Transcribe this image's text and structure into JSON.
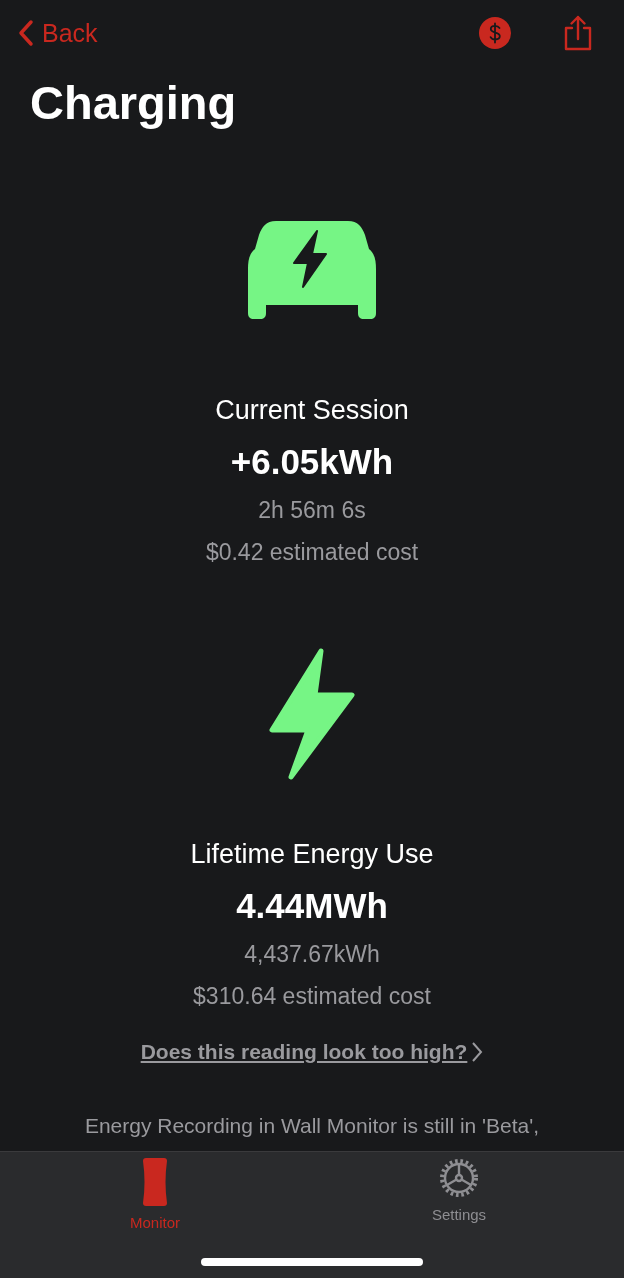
{
  "nav": {
    "back_label": "Back"
  },
  "title": "Charging",
  "sections": [
    {
      "kind": "car",
      "heading": "Current Session",
      "value": "+6.05kWh",
      "details": [
        "2h 56m 6s",
        "$0.42 estimated cost"
      ]
    },
    {
      "kind": "bolt",
      "heading": "Lifetime Energy Use",
      "value": "4.44MWh",
      "details": [
        "4,437.67kWh",
        "$310.64 estimated cost"
      ]
    }
  ],
  "help_link": "Does this reading look too high?",
  "note": "Energy Recording in Wall Monitor is still in 'Beta',",
  "tabs": [
    {
      "kind": "monitor",
      "label": "Monitor",
      "selected": true
    },
    {
      "kind": "settings",
      "label": "Settings",
      "selected": false
    }
  ]
}
